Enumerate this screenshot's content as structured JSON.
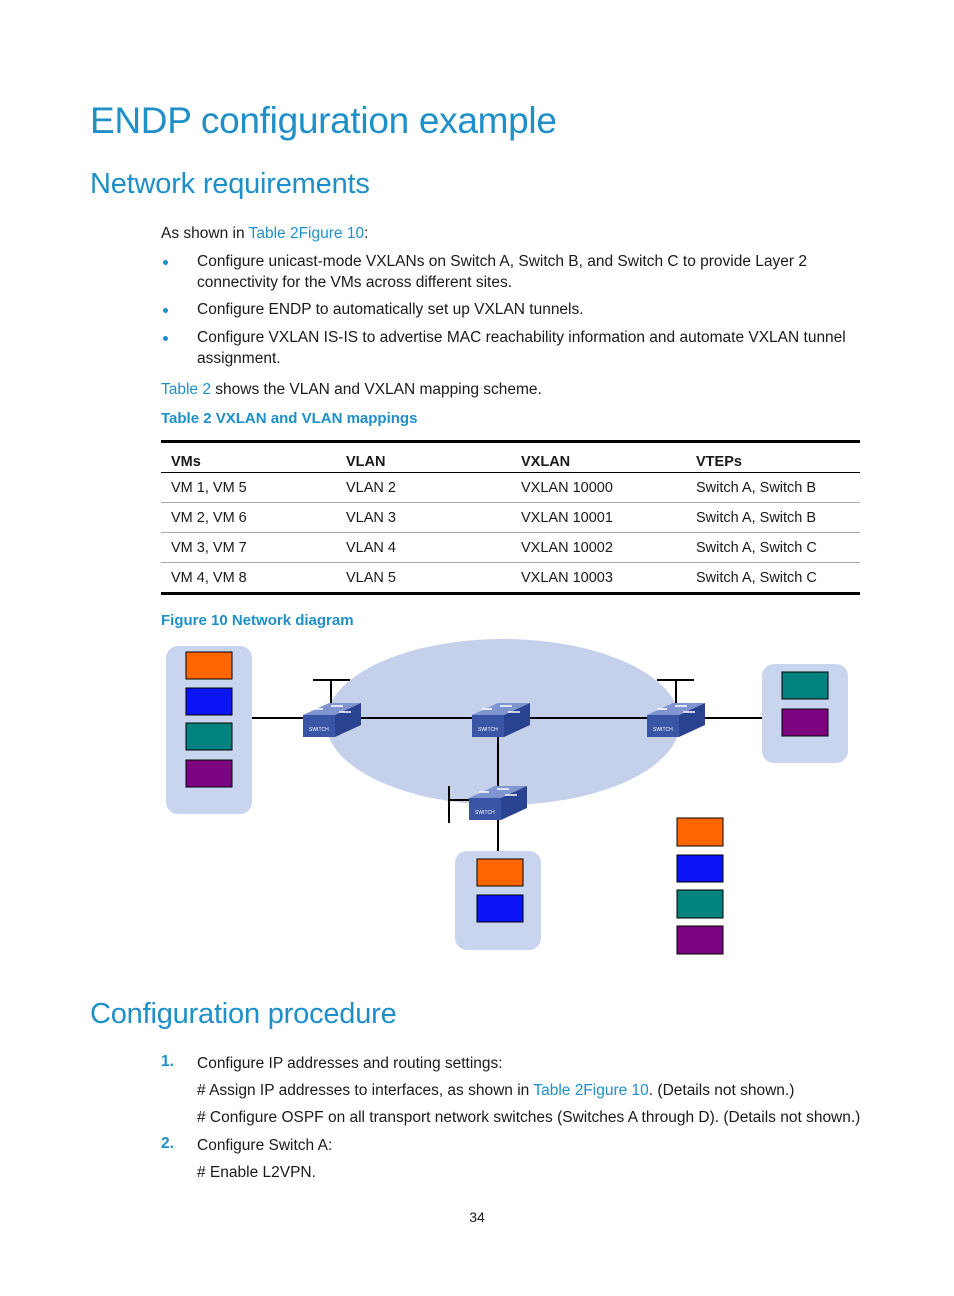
{
  "title": "ENDP configuration example",
  "sections": {
    "network_requirements": {
      "heading": "Network requirements",
      "intro_prefix": "As shown in ",
      "intro_link": "Table 2Figure 10",
      "intro_suffix": ":",
      "bullets": [
        "Configure unicast-mode VXLANs on Switch A, Switch B, and Switch C to provide Layer 2 connectivity for the VMs across different sites.",
        "Configure ENDP to automatically set up VXLAN tunnels.",
        "Configure VXLAN IS-IS to advertise MAC reachability information and automate VXLAN tunnel assignment."
      ],
      "table_ref_link": "Table 2",
      "table_ref_text": " shows the VLAN and VXLAN mapping scheme.",
      "table_caption": "Table 2 VXLAN and VLAN mappings",
      "table": {
        "headers": [
          "VMs",
          "VLAN",
          "VXLAN",
          "VTEPs"
        ],
        "rows": [
          [
            "VM 1, VM 5",
            "VLAN 2",
            "VXLAN 10000",
            "Switch A, Switch B"
          ],
          [
            "VM 2, VM 6",
            "VLAN 3",
            "VXLAN 10001",
            "Switch A, Switch B"
          ],
          [
            "VM 3, VM 7",
            "VLAN 4",
            "VXLAN 10002",
            "Switch A, Switch C"
          ],
          [
            "VM 4, VM 8",
            "VLAN 5",
            "VXLAN 10003",
            "Switch A, Switch C"
          ]
        ]
      },
      "figure_caption": "Figure 10 Network diagram",
      "figure": {
        "switch_label": "SWITCH",
        "colors": {
          "cloud": "#c5d0ea",
          "site_box": "#c9d4ee",
          "switch_face": "#3c57a8",
          "vm_orange": "#ff6600",
          "vm_blue": "#0a14f5",
          "vm_teal": "#00827f",
          "vm_purple": "#7d0480"
        },
        "sites": {
          "left": [
            "vm_orange",
            "vm_blue",
            "vm_teal",
            "vm_purple"
          ],
          "right": [
            "vm_teal",
            "vm_purple"
          ],
          "bottom": [
            "vm_orange",
            "vm_blue"
          ],
          "legend": [
            "vm_orange",
            "vm_blue",
            "vm_teal",
            "vm_purple"
          ]
        }
      }
    },
    "configuration_procedure": {
      "heading": "Configuration procedure",
      "steps": [
        {
          "number": "1.",
          "text": "Configure IP addresses and routing settings:",
          "sub": [
            {
              "prefix": "# Assign IP addresses to interfaces, as shown in ",
              "link": "Table 2Figure 10",
              "suffix": ". (Details not shown.)"
            },
            {
              "prefix": "# Configure OSPF on all transport network switches (Switches A through D). (Details not shown.)",
              "link": "",
              "suffix": ""
            }
          ]
        },
        {
          "number": "2.",
          "text": "Configure Switch A:",
          "sub": [
            {
              "prefix": "# Enable L2VPN.",
              "link": "",
              "suffix": ""
            }
          ]
        }
      ]
    }
  },
  "page_number": "34"
}
